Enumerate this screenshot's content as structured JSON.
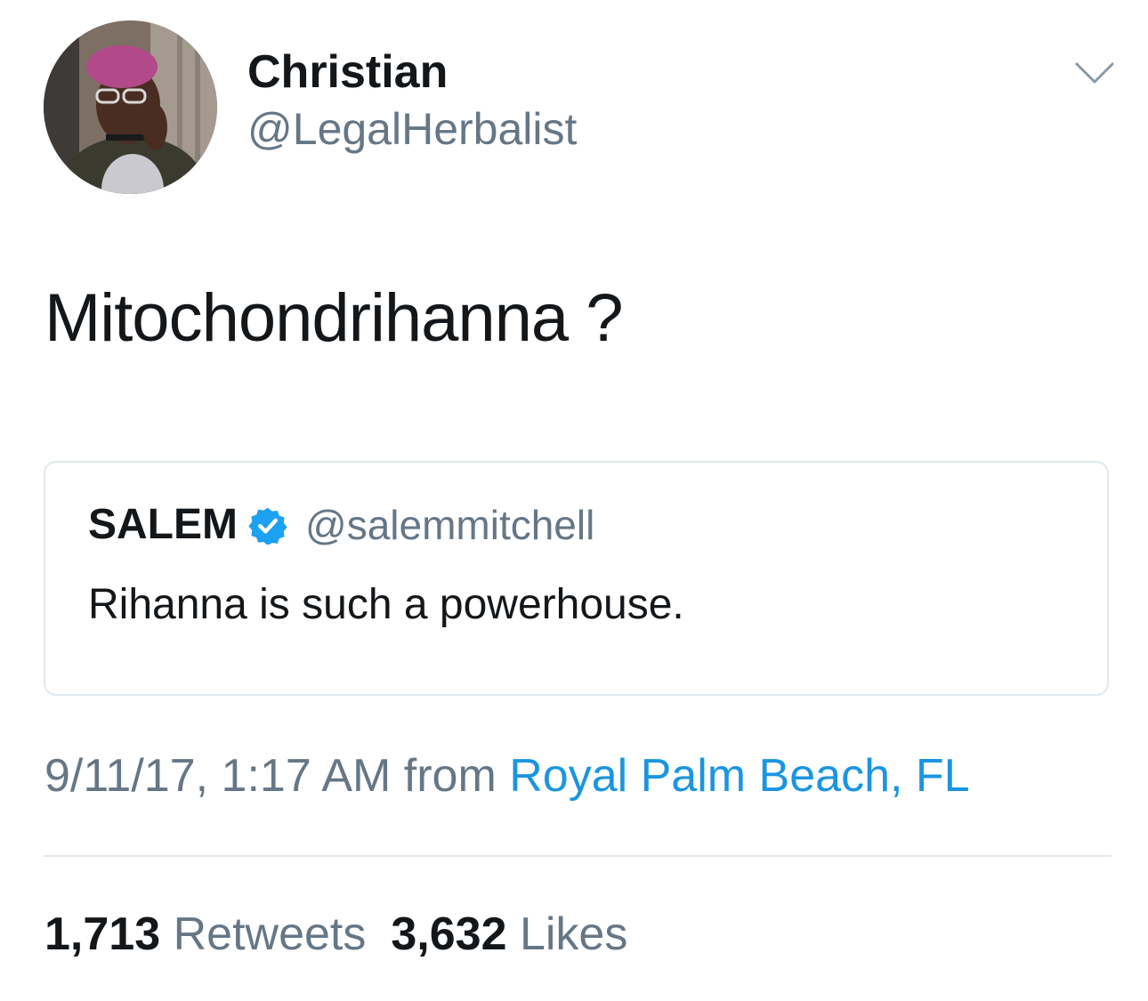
{
  "colors": {
    "text_primary": "#14171a",
    "text_secondary": "#657786",
    "link": "#1b95e0",
    "border": "#e1e8ed",
    "verified": "#1da1f2"
  },
  "tweet": {
    "author": {
      "display_name": "Christian",
      "handle": "@LegalHerbalist",
      "avatar_icon": "profile-photo"
    },
    "menu_icon": "chevron-down-icon",
    "text": "Mitochondrihanna ?",
    "quoted_tweet": {
      "display_name": "SALEM",
      "verified_icon": "verified-badge-icon",
      "handle": "@salemmitchell",
      "text": "Rihanna is such a powerhouse."
    },
    "meta": {
      "date": "9/11/17, 1:17 AM",
      "from": "from",
      "location": "Royal Palm Beach, FL"
    },
    "stats": {
      "retweets_count": "1,713",
      "retweets_label": "Retweets",
      "likes_count": "3,632",
      "likes_label": "Likes"
    }
  }
}
